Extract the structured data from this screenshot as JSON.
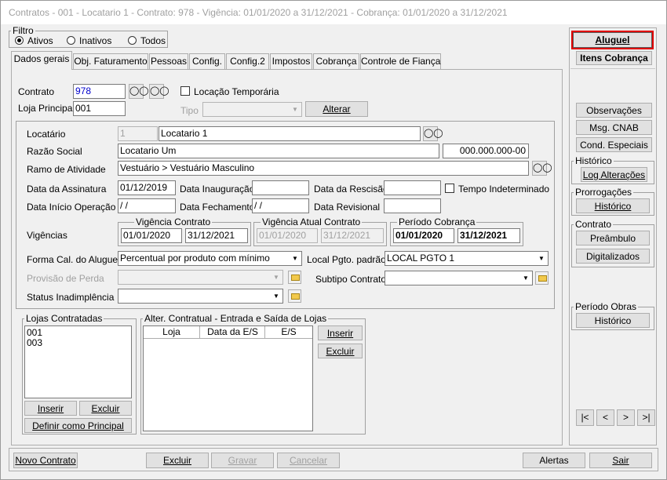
{
  "title": "Contratos - 001 - Locatario 1 - Contrato: 978 - Vigência: 01/01/2020 a 31/12/2021 - Cobrança: 01/01/2020 a 31/12/2021",
  "filter": {
    "label": "Filtro",
    "options": [
      "Ativos",
      "Inativos",
      "Todos"
    ],
    "selected": "Ativos"
  },
  "tabs": [
    "Dados gerais",
    "Obj. Faturamento",
    "Pessoas",
    "Config.",
    "Config.2",
    "Impostos",
    "Cobrança",
    "Controle de Fiança"
  ],
  "active_tab": "Dados gerais",
  "contract": {
    "contrato_label": "Contrato",
    "contrato_value": "978",
    "locacao_temporaria_label": "Locação Temporária",
    "loja_principal_label": "Loja Principal",
    "loja_principal_value": "001",
    "tipo_label": "Tipo",
    "tipo_value": "",
    "alterar_label": "Alterar"
  },
  "tenant": {
    "locatario_label": "Locatário",
    "locatario_code": "1",
    "locatario_name": "Locatario 1",
    "razao_label": "Razão Social",
    "razao_value": "Locatario Um",
    "cnpj_value": "000.000.000-00",
    "ramo_label": "Ramo de Atividade",
    "ramo_value": "Vestuário > Vestuário Masculino"
  },
  "dates": {
    "assinatura_label": "Data da Assinatura",
    "assinatura_value": "01/12/2019",
    "inauguracao_label": "Data Inauguração",
    "inauguracao_value": "",
    "rescisao_label": "Data da Rescisão",
    "rescisao_value": "",
    "tempo_indet_label": "Tempo Indeterminado",
    "inicio_op_label": "Data Início Operação",
    "inicio_op_value": " / /",
    "fechamento_label": "Data Fechamento",
    "fechamento_value": " / /",
    "revisional_label": "Data Revisional",
    "revisional_value": ""
  },
  "vigencias": {
    "label": "Vigências",
    "contrato_title": "Vigência Contrato",
    "contrato_start": "01/01/2020",
    "contrato_end": "31/12/2021",
    "atual_title": "Vigência Atual Contrato",
    "atual_start": "01/01/2020",
    "atual_end": "31/12/2021",
    "cobranca_title": "Período Cobrança",
    "cobranca_start": "01/01/2020",
    "cobranca_end": "31/12/2021"
  },
  "options": {
    "forma_label": "Forma Cal. do Aluguel",
    "forma_value": "Percentual por produto com mínimo",
    "local_pgto_label": "Local Pgto. padrão",
    "local_pgto_value": "LOCAL PGTO 1",
    "provisao_label": "Provisão de Perda",
    "provisao_value": "",
    "subtipo_label": "Subtipo Contrato",
    "subtipo_value": "",
    "status_label": "Status Inadimplência",
    "status_value": ""
  },
  "lojas": {
    "title": "Lojas Contratadas",
    "items": [
      "001",
      "003"
    ],
    "inserir": "Inserir",
    "excluir": "Excluir",
    "definir": "Definir como Principal"
  },
  "alter": {
    "title": "Alter. Contratual - Entrada e Saída de Lojas",
    "columns": [
      "Loja",
      "Data da E/S",
      "E/S"
    ],
    "inserir": "Inserir",
    "excluir": "Excluir"
  },
  "side": {
    "aluguel": "Aluguel",
    "itens_cobranca": "Itens Cobrança",
    "observacoes": "Observações",
    "msg_cnab": "Msg. CNAB",
    "cond_especiais": "Cond. Especiais",
    "historico_title": "Histórico",
    "log_alteracoes": "Log Alterações",
    "prorrogacoes_title": "Prorrogações",
    "prorrog_historico": "Histórico",
    "contrato_title": "Contrato",
    "preambulo": "Preâmbulo",
    "digitalizados": "Digitalizados",
    "periodo_obras_title": "Período Obras",
    "obras_historico": "Histórico",
    "nav": [
      "|<",
      "<",
      ">",
      ">|"
    ]
  },
  "footer": {
    "novo_contrato": "Novo Contrato",
    "excluir": "Excluir",
    "gravar": "Gravar",
    "cancelar": "Cancelar",
    "alertas": "Alertas",
    "sair": "Sair"
  },
  "colors": {
    "highlight": "#e00000",
    "link_blue": "#0000cc",
    "disabled": "#a0a0a0"
  }
}
